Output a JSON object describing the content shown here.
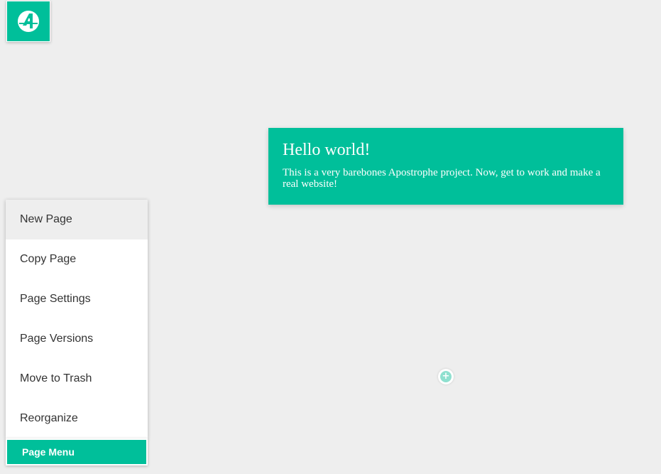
{
  "brand": {
    "logo_icon": "apostrophe-logo-icon",
    "accent_color": "#00bf9a"
  },
  "hero": {
    "title": "Hello world!",
    "text": "This is a very barebones Apostrophe project. Now, get to work and make a real website!"
  },
  "widget": {
    "add_icon": "plus-circle-icon"
  },
  "page_menu": {
    "items": [
      {
        "label": "New Page"
      },
      {
        "label": "Copy Page"
      },
      {
        "label": "Page Settings"
      },
      {
        "label": "Page Versions"
      },
      {
        "label": "Move to Trash"
      },
      {
        "label": "Reorganize"
      }
    ],
    "button_label": "Page Menu"
  }
}
